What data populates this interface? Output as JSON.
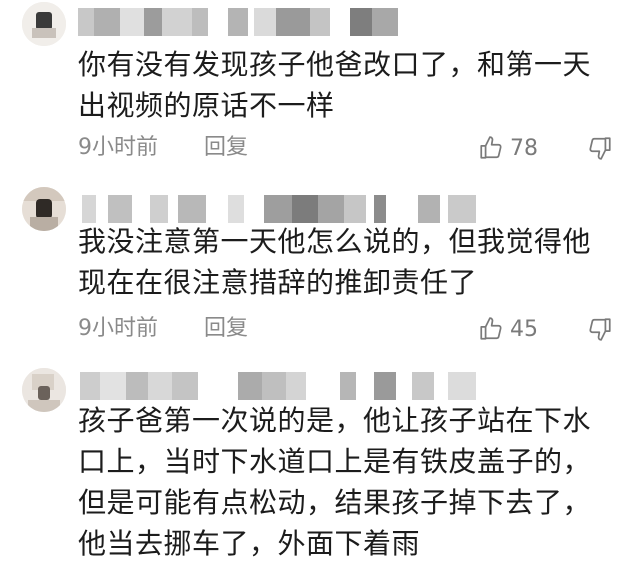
{
  "comments": [
    {
      "text": "你有没有发现孩子他爸改口了，和第一天出视频的原话不一样",
      "time": "9小时前",
      "reply_label": "回复",
      "likes": "78"
    },
    {
      "text": "我没注意第一天他怎么说的，但我觉得他现在在很注意措辞的推卸责任了",
      "time": "9小时前",
      "reply_label": "回复",
      "likes": "45"
    },
    {
      "text": "孩子爸第一次说的是，他让孩子站在下水口上，当时下水道口上是有铁皮盖子的，但是可能有点松动，结果孩子掉下去了，他当去挪车了，外面下着雨"
    }
  ],
  "icons": {
    "like": "thumbs-up-icon",
    "dislike": "thumbs-down-icon"
  }
}
